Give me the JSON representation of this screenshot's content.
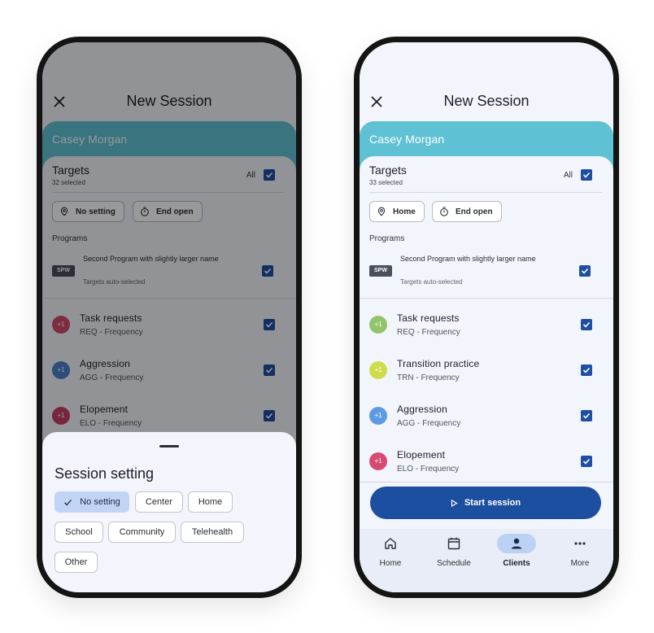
{
  "left_phone": {
    "header": {
      "title": "New Session",
      "close_icon": "close-icon"
    },
    "client_name": "Casey Morgan",
    "targets": {
      "title": "Targets",
      "count": "32 selected",
      "all_label": "All",
      "all_checked": true
    },
    "chips": {
      "setting": "No setting",
      "end": "End open"
    },
    "programs": {
      "label": "Programs",
      "items": [
        {
          "badge": "SPW",
          "name": "Second Program with slightly larger name",
          "sub": "Targets auto-selected",
          "checked": true
        }
      ]
    },
    "target_items": [
      {
        "badge": "+1",
        "name": "Task requests",
        "code": "REQ - Frequency",
        "color": "#d24a6b",
        "checked": true
      },
      {
        "badge": "+1",
        "name": "Aggression",
        "code": "AGG - Frequency",
        "color": "#4d7fcf",
        "checked": true
      },
      {
        "badge": "+1",
        "name": "Elopement",
        "code": "ELO - Frequency",
        "color": "#c94067",
        "checked": true
      }
    ],
    "sheet": {
      "title": "Session setting",
      "options": [
        {
          "label": "No setting",
          "selected": true
        },
        {
          "label": "Center",
          "selected": false
        },
        {
          "label": "Home",
          "selected": false
        },
        {
          "label": "School",
          "selected": false
        },
        {
          "label": "Community",
          "selected": false
        },
        {
          "label": "Telehealth",
          "selected": false
        },
        {
          "label": "Other",
          "selected": false
        }
      ]
    }
  },
  "right_phone": {
    "header": {
      "title": "New Session",
      "close_icon": "close-icon"
    },
    "client_name": "Casey Morgan",
    "targets": {
      "title": "Targets",
      "count": "33 selected",
      "all_label": "All",
      "all_checked": true
    },
    "chips": {
      "setting": "Home",
      "end": "End open"
    },
    "programs": {
      "label": "Programs",
      "items": [
        {
          "badge": "SPW",
          "name": "Second Program with slightly larger name",
          "sub": "Targets auto-selected",
          "checked": true
        }
      ]
    },
    "target_items": [
      {
        "badge": "+1",
        "name": "Task requests",
        "code": "REQ - Frequency",
        "color": "#92c46a",
        "checked": true
      },
      {
        "badge": "+1",
        "name": "Transition practice",
        "code": "TRN - Frequency",
        "color": "#cfdc4a",
        "checked": true
      },
      {
        "badge": "+1",
        "name": "Aggression",
        "code": "AGG - Frequency",
        "color": "#5d9be3",
        "checked": true
      },
      {
        "badge": "+1",
        "name": "Elopement",
        "code": "ELO - Frequency",
        "color": "#d84a72",
        "checked": true
      }
    ],
    "start_button": {
      "label": "Start session",
      "icon": "play-icon"
    },
    "nav": [
      {
        "label": "Home",
        "icon": "home-icon",
        "active": false
      },
      {
        "label": "Schedule",
        "icon": "calendar-icon",
        "active": false
      },
      {
        "label": "Clients",
        "icon": "person-icon",
        "active": true
      },
      {
        "label": "More",
        "icon": "more-icon",
        "active": false
      }
    ]
  },
  "colors": {
    "client_band": "#5fc1d4",
    "primary": "#1d4fa1",
    "checkbox": "#1e4fa3",
    "selected_chip": "#c2d4f6",
    "background": "#f3f5fc"
  }
}
